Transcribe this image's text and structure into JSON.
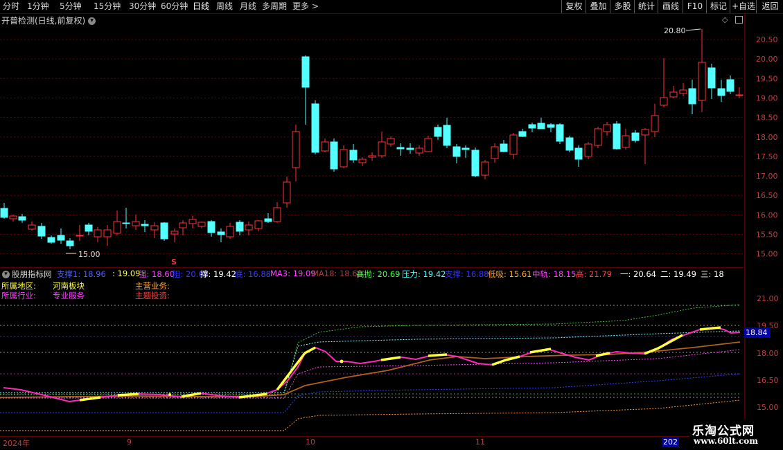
{
  "toolbar": {
    "periods": [
      "分时",
      "1分钟",
      "5分钟",
      "15分钟",
      "30分钟",
      "60分钟",
      "日线",
      "周线",
      "月线",
      "多周期",
      "更多"
    ],
    "active_period": "日线",
    "right_buttons": [
      "复权",
      "叠加",
      "多股",
      "统计",
      "画线",
      "F10",
      "标记",
      "+自选",
      "返回"
    ]
  },
  "main_chart": {
    "title": "开普检测(日线,前复权)",
    "price_axis": [
      "20.50",
      "20.00",
      "19.50",
      "19.00",
      "18.50",
      "18.00",
      "17.50",
      "17.00",
      "16.50",
      "16.00",
      "15.50",
      "15.00"
    ],
    "high_label": "20.80",
    "low_label": "15.00",
    "signal_mark": "S",
    "colors": {
      "up": "#ff3333",
      "down": "#54ffff",
      "grid": "#6b0000",
      "axis_text": "#c04040"
    }
  },
  "indicator": {
    "name": "股朋指标网",
    "values": [
      {
        "label": "支撑1: 18.96",
        "color": "#4d5cff"
      },
      {
        "label": ": 19.09",
        "color": "#ffff40"
      },
      {
        "label": "强: 18.60",
        "color": "#ff40ff"
      },
      {
        "label": "阻: 20.69",
        "color": "#3333ff"
      },
      {
        "label": "撑: 19.42",
        "color": "#ffffff"
      },
      {
        "label": "底: 16.88",
        "color": "#3a3aff"
      },
      {
        "label": "MA3: 19.09",
        "color": "#ff40ff"
      },
      {
        "label": "MA18: 18.60",
        "color": "#a04040"
      },
      {
        "label": "高抛: 20.69",
        "color": "#40ff40"
      },
      {
        "label": "压力: 19.42",
        "color": "#40ffff"
      },
      {
        "label": "支撑: 16.88",
        "color": "#3333ff"
      },
      {
        "label": "低吸: 15.61",
        "color": "#ffaa40"
      },
      {
        "label": "中轨: 18.15",
        "color": "#ff40ff"
      },
      {
        "label": "高: 21.79",
        "color": "#ff4040"
      },
      {
        "label": "一: 20.64",
        "color": "#ffffff"
      },
      {
        "label": "二: 19.49",
        "color": "#ffffff"
      },
      {
        "label": "三: 18",
        "color": "#ffffff"
      }
    ],
    "info": {
      "region_label": "所属地区:",
      "region_value": "河南板块",
      "industry_label": "所属行业:",
      "industry_value": "专业服务",
      "business_label": "主营业务:",
      "theme_label": "主题投资:"
    },
    "axis": [
      "21.00",
      "19.50",
      "18.00",
      "16.50",
      "15.00"
    ],
    "current_value": "18.84"
  },
  "date_axis": [
    "2024年",
    "9",
    "10",
    "11",
    "202"
  ],
  "watermark": {
    "line1": "乐淘公式网",
    "line2": "www.60lt.com"
  }
}
